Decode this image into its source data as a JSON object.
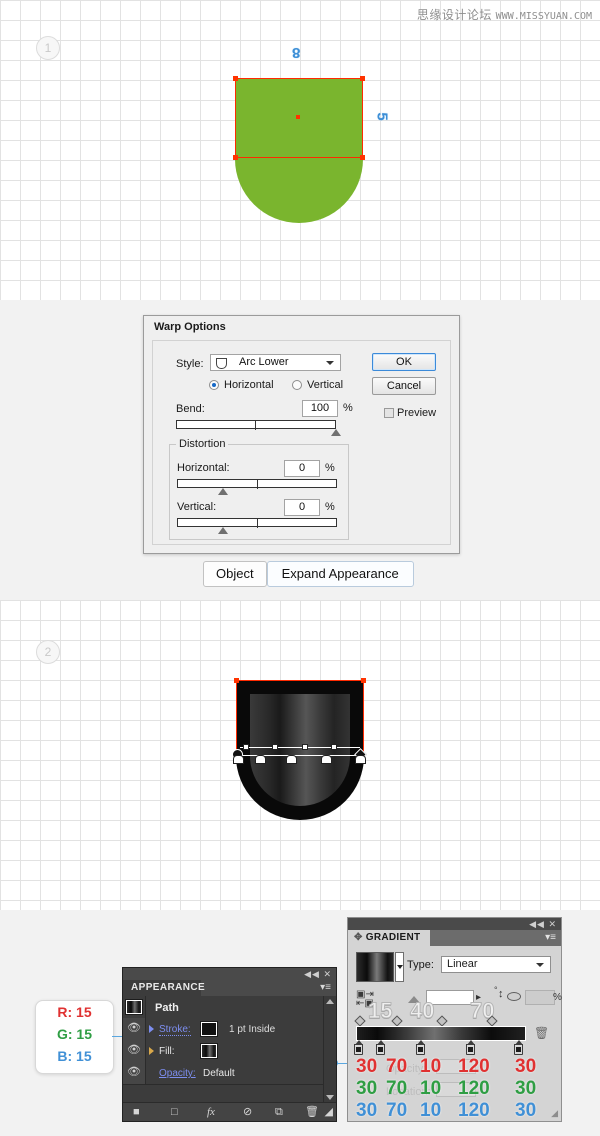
{
  "watermark": {
    "cn": "思缘设计论坛",
    "url": "WWW.MISSYUAN.COM"
  },
  "canvas_one": {
    "step": "1",
    "shape_fill": "#7ab52e",
    "selection_color": "#ff2a00",
    "measure_width": "8",
    "measure_height": "5"
  },
  "canvas_two": {
    "step": "2",
    "shape_fill": "#090909"
  },
  "warp_dialog": {
    "title": "Warp Options",
    "style_label": "Style:",
    "style_value": "Arc Lower",
    "orientation": {
      "horizontal": "Horizontal",
      "vertical": "Vertical",
      "selected": "Horizontal"
    },
    "bend_label": "Bend:",
    "bend_value": "100",
    "distortion_label": "Distortion",
    "distortion_horizontal_label": "Horizontal:",
    "distortion_horizontal_value": "0",
    "distortion_vertical_label": "Vertical:",
    "distortion_vertical_value": "0",
    "percent": "%",
    "ok": "OK",
    "cancel": "Cancel",
    "preview": "Preview"
  },
  "expand_bar": {
    "object": "Object",
    "expand_appearance": "Expand Appearance"
  },
  "rgb_callout": {
    "r": "R: 15",
    "g": "G: 15",
    "b": "B: 15"
  },
  "appearance_panel": {
    "tab": "APPEARANCE",
    "collapse": "◀◀",
    "close": "✕",
    "rows": [
      {
        "label": "Path"
      },
      {
        "label": "Stroke:",
        "detail": "1 pt  Inside"
      },
      {
        "label": "Fill:",
        "detail": ""
      },
      {
        "label": "Opacity:",
        "detail": "Default"
      }
    ],
    "footer_icons": [
      "add-new-stroke",
      "add-new-fill",
      "add-new-effect",
      "clear-appearance",
      "duplicate-item",
      "delete-item"
    ]
  },
  "gradient_panel": {
    "tab": "GRADIENT",
    "collapse": "◀◀",
    "close": "✕",
    "type_label": "Type:",
    "type_value": "Linear",
    "angle_value": "",
    "aspect_value": "",
    "percent": "%",
    "ghost_opacity_label": "Opacity:",
    "ghost_location_label": "Location:",
    "midpoint_labels": [
      "15",
      "40",
      "70"
    ],
    "stops": [
      {
        "r": "30",
        "g": "30",
        "b": "30"
      },
      {
        "r": "70",
        "g": "70",
        "b": "70"
      },
      {
        "r": "10",
        "g": "10",
        "b": "10"
      },
      {
        "r": "120",
        "g": "120",
        "b": "120"
      },
      {
        "r": "30",
        "g": "30",
        "b": "30"
      }
    ],
    "colors": {
      "red": "#e03131",
      "green": "#2f9e44",
      "blue": "#4090d6"
    }
  }
}
